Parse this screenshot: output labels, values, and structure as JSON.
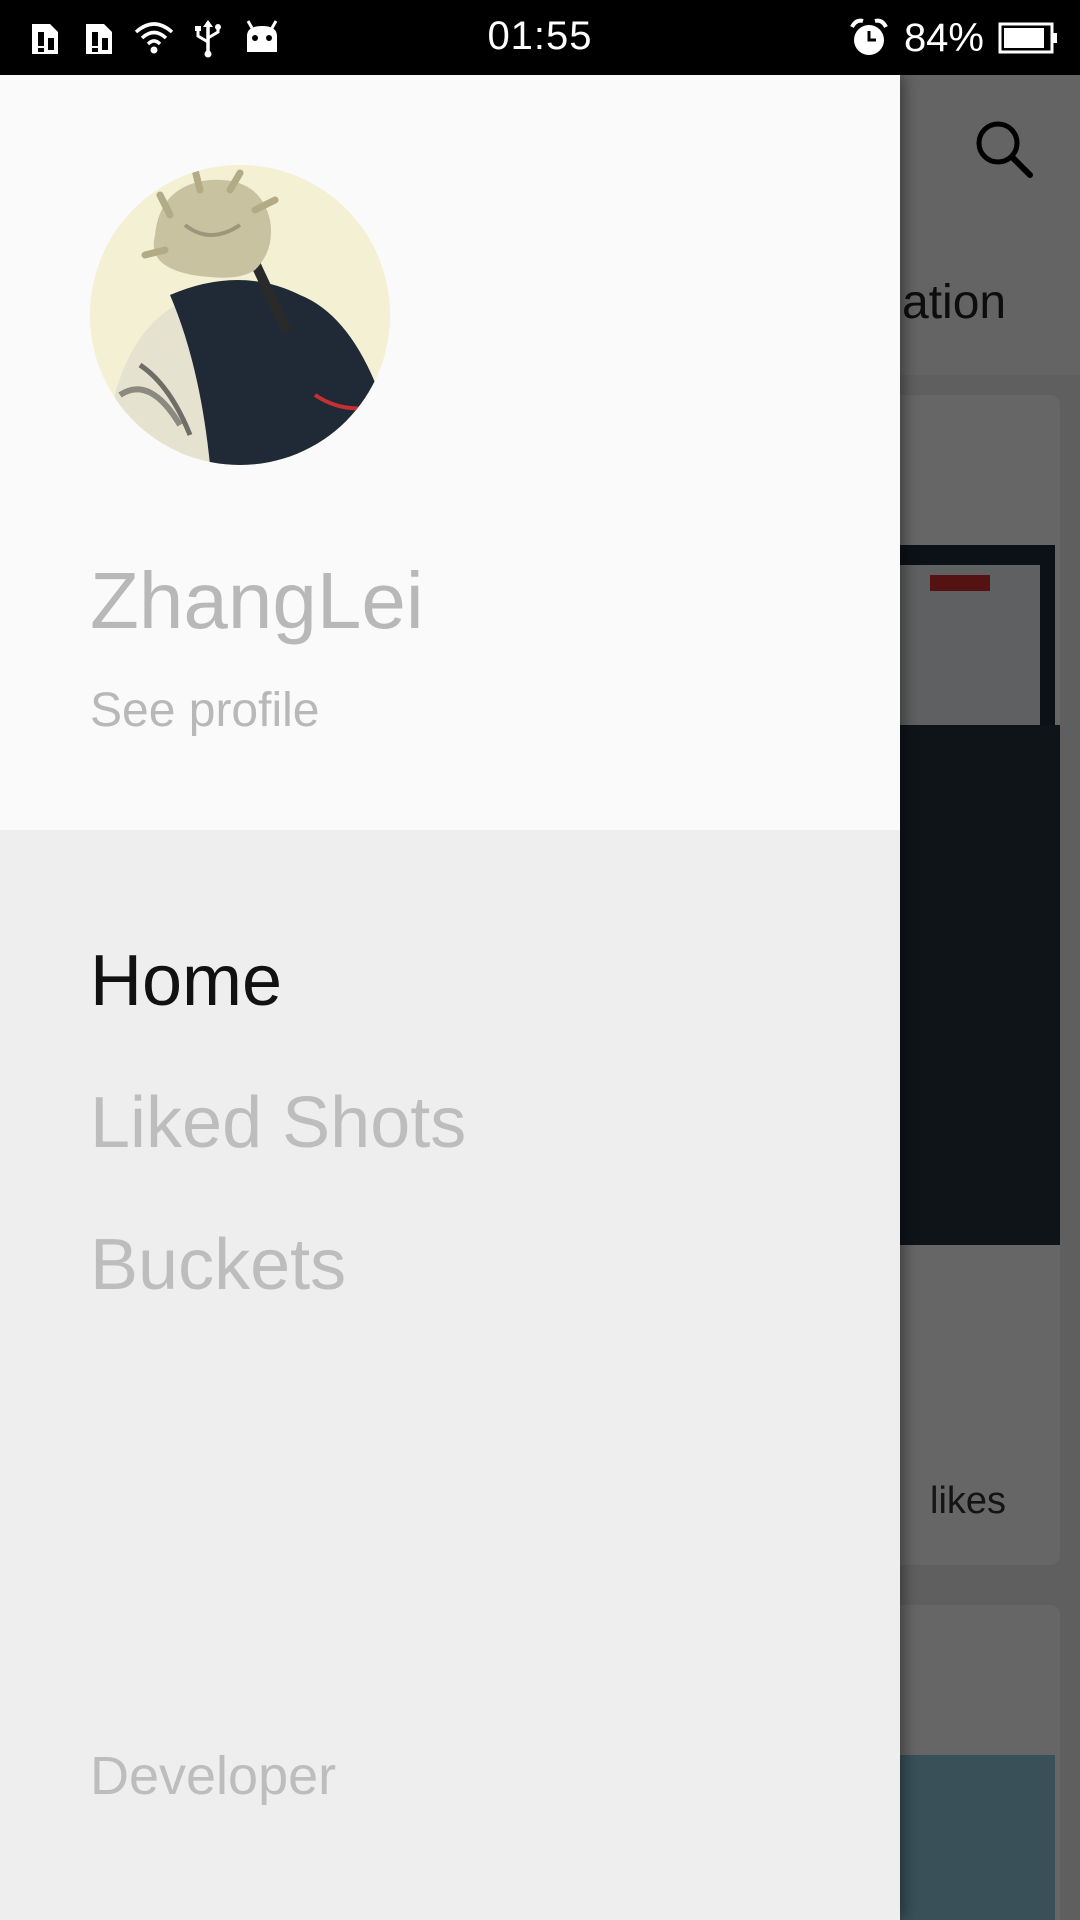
{
  "status_bar": {
    "time": "01:55",
    "battery": "84%",
    "left_icons": [
      "sim-warning-icon",
      "sim-warning-icon",
      "wifi-icon",
      "usb-icon",
      "android-debug-icon"
    ],
    "right_icons": [
      "alarm-icon",
      "battery-icon"
    ]
  },
  "background": {
    "tab_partial": "ation",
    "likes_partial": "likes",
    "icons": [
      "search-icon"
    ]
  },
  "drawer": {
    "user_name": "ZhangLei",
    "see_profile": "See profile",
    "menu": [
      {
        "label": "Home",
        "active": true
      },
      {
        "label": "Liked Shots",
        "active": false
      },
      {
        "label": "Buckets",
        "active": false
      }
    ],
    "footer": "Developer"
  },
  "colors": {
    "header_bg": "#fafafa",
    "drawer_bg": "#eeeeee",
    "active_text": "#111111",
    "inactive_text": "#bdbdbd"
  }
}
